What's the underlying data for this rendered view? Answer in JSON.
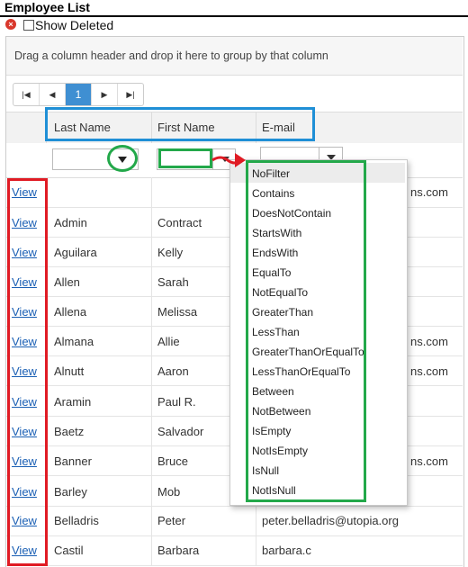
{
  "window": {
    "title": "Employee List"
  },
  "toolbar": {
    "close_icon": "close-icon",
    "show_deleted_label": "Show Deleted",
    "show_deleted_checked": false
  },
  "grid": {
    "group_panel_text": "Drag a column header and drop it here to group by that column",
    "pager": {
      "first": "first-page-icon",
      "prev": "prev-page-icon",
      "current_page": "1",
      "next": "next-page-icon",
      "last": "last-page-icon"
    },
    "columns": [
      "Last Name",
      "First Name",
      "E-mail"
    ],
    "view_label": "View",
    "rows": [
      {
        "last": "",
        "first": "",
        "email": "ns.com"
      },
      {
        "last": "Admin",
        "first": "Contract",
        "email": ""
      },
      {
        "last": "Aguilara",
        "first": "Kelly",
        "email": ""
      },
      {
        "last": "Allen",
        "first": "Sarah",
        "email": ""
      },
      {
        "last": "Allena",
        "first": "Melissa",
        "email": ""
      },
      {
        "last": "Almana",
        "first": "Allie",
        "email": "ns.com"
      },
      {
        "last": "Alnutt",
        "first": "Aaron",
        "email": "ns.com"
      },
      {
        "last": "Aramin",
        "first": "Paul R.",
        "email": ""
      },
      {
        "last": "Baetz",
        "first": "Salvador",
        "email": ""
      },
      {
        "last": "Banner",
        "first": "Bruce",
        "email": "ns.com"
      },
      {
        "last": "Barley",
        "first": "Mob",
        "email": ""
      },
      {
        "last": "Belladris",
        "first": "Peter",
        "email": "peter.belladris@utopia.org"
      },
      {
        "last": "Castil",
        "first": "Barbara",
        "email": "barbara.c"
      }
    ]
  },
  "filter_menu": {
    "options": [
      "NoFilter",
      "Contains",
      "DoesNotContain",
      "StartsWith",
      "EndsWith",
      "EqualTo",
      "NotEqualTo",
      "GreaterThan",
      "LessThan",
      "GreaterThanOrEqualTo",
      "LessThanOrEqualTo",
      "Between",
      "NotBetween",
      "IsEmpty",
      "NotIsEmpty",
      "IsNull",
      "NotIsNull"
    ],
    "selected": "NoFilter"
  },
  "annotations": {
    "red": "#e01b24",
    "blue": "#1f8fd6",
    "green": "#23a84a"
  }
}
